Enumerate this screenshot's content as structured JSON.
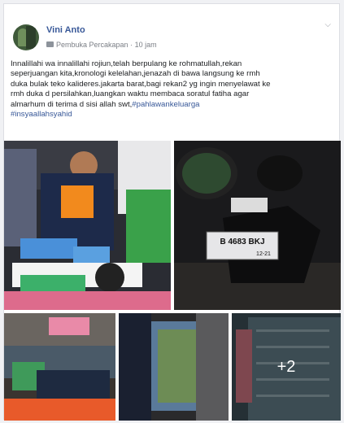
{
  "post": {
    "author": "Vini Anto",
    "role": "Pembuka Percakapan",
    "time": "10 jam",
    "text_lines": [
      "Innalillahi wa innalillahi rojiun,telah berpulang ke rohmatullah,rekan",
      "seperjuangan kita,kronologi kelelahan,jenazah di bawa langsung ke rmh",
      "duka bulak teko kalideres.jakarta barat,bagi rekan2 yg ingin menyelawat ke",
      "rmh duka d persilahkan,luangkan waktu membaca soratul fatiha agar",
      "almarhum di terima d sisi allah swt,"
    ],
    "hashtag1": "#pahlawankeluarga",
    "hashtag2": "#insyaallahsyahid"
  },
  "photos": {
    "plate_line1": "B 4683 BKJ",
    "plate_line2": "12-21",
    "more_count": "+2"
  },
  "colors": {
    "link": "#385898",
    "text": "#1c1e21",
    "meta": "#7b7f86"
  }
}
